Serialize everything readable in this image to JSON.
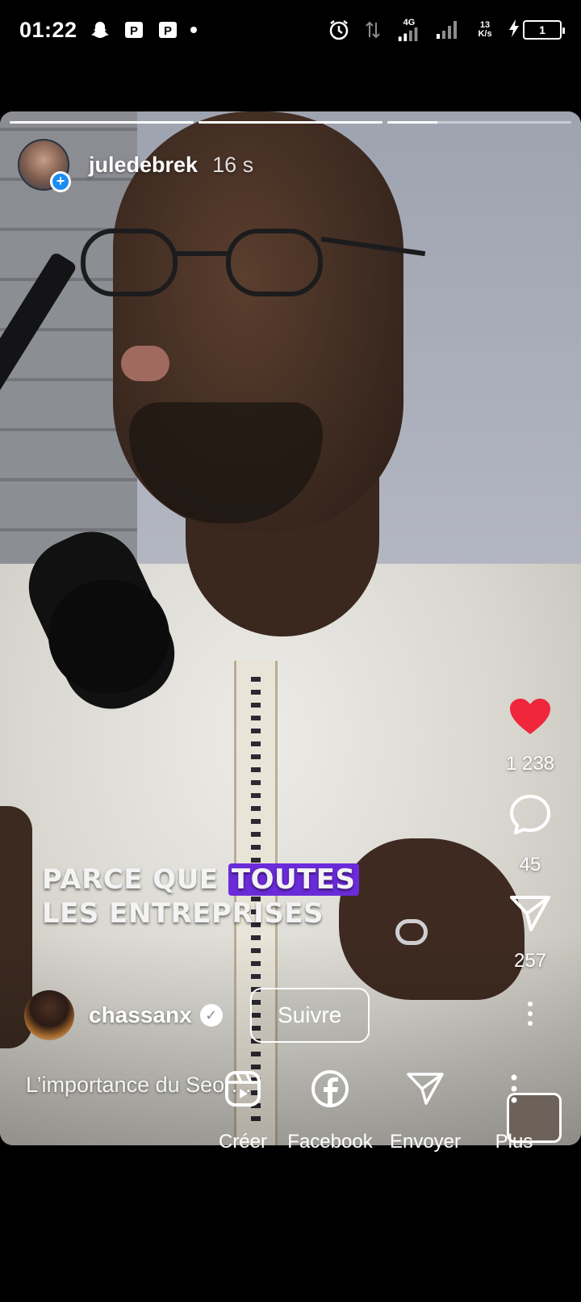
{
  "status_bar": {
    "time": "01:22",
    "network": "4G",
    "speed_value": "13",
    "speed_unit": "K/s",
    "battery": "1",
    "icons": [
      "snapchat-icon",
      "parking-icon",
      "parking-icon",
      "alarm-icon",
      "data-arrows-icon",
      "signal-icon",
      "signal-icon",
      "charging-icon",
      "battery-icon"
    ]
  },
  "story": {
    "progress": [
      1.0,
      1.0,
      0.27,
      0.0
    ],
    "username": "juledebrek",
    "time_ago": "16 s",
    "caption_line1_before": "PARCE QUE ",
    "caption_line1_highlight": "TOUTES",
    "caption_line2": "LES ENTREPRISES",
    "colors": {
      "highlight": "#6b2bd9",
      "like": "#f0263d",
      "badge": "#1b8cf2"
    }
  },
  "reel": {
    "author": "chassanx",
    "follow_label": "Suivre",
    "description": "L’importance du Seo …",
    "likes": "1 238",
    "comments": "45",
    "shares": "257"
  },
  "share_bar": {
    "items": [
      {
        "label": "Créer",
        "icon": "reels-icon"
      },
      {
        "label": "Facebook",
        "icon": "facebook-icon"
      },
      {
        "label": "Envoyer",
        "icon": "send-icon"
      },
      {
        "label": "Plus",
        "icon": "more-icon"
      }
    ]
  }
}
